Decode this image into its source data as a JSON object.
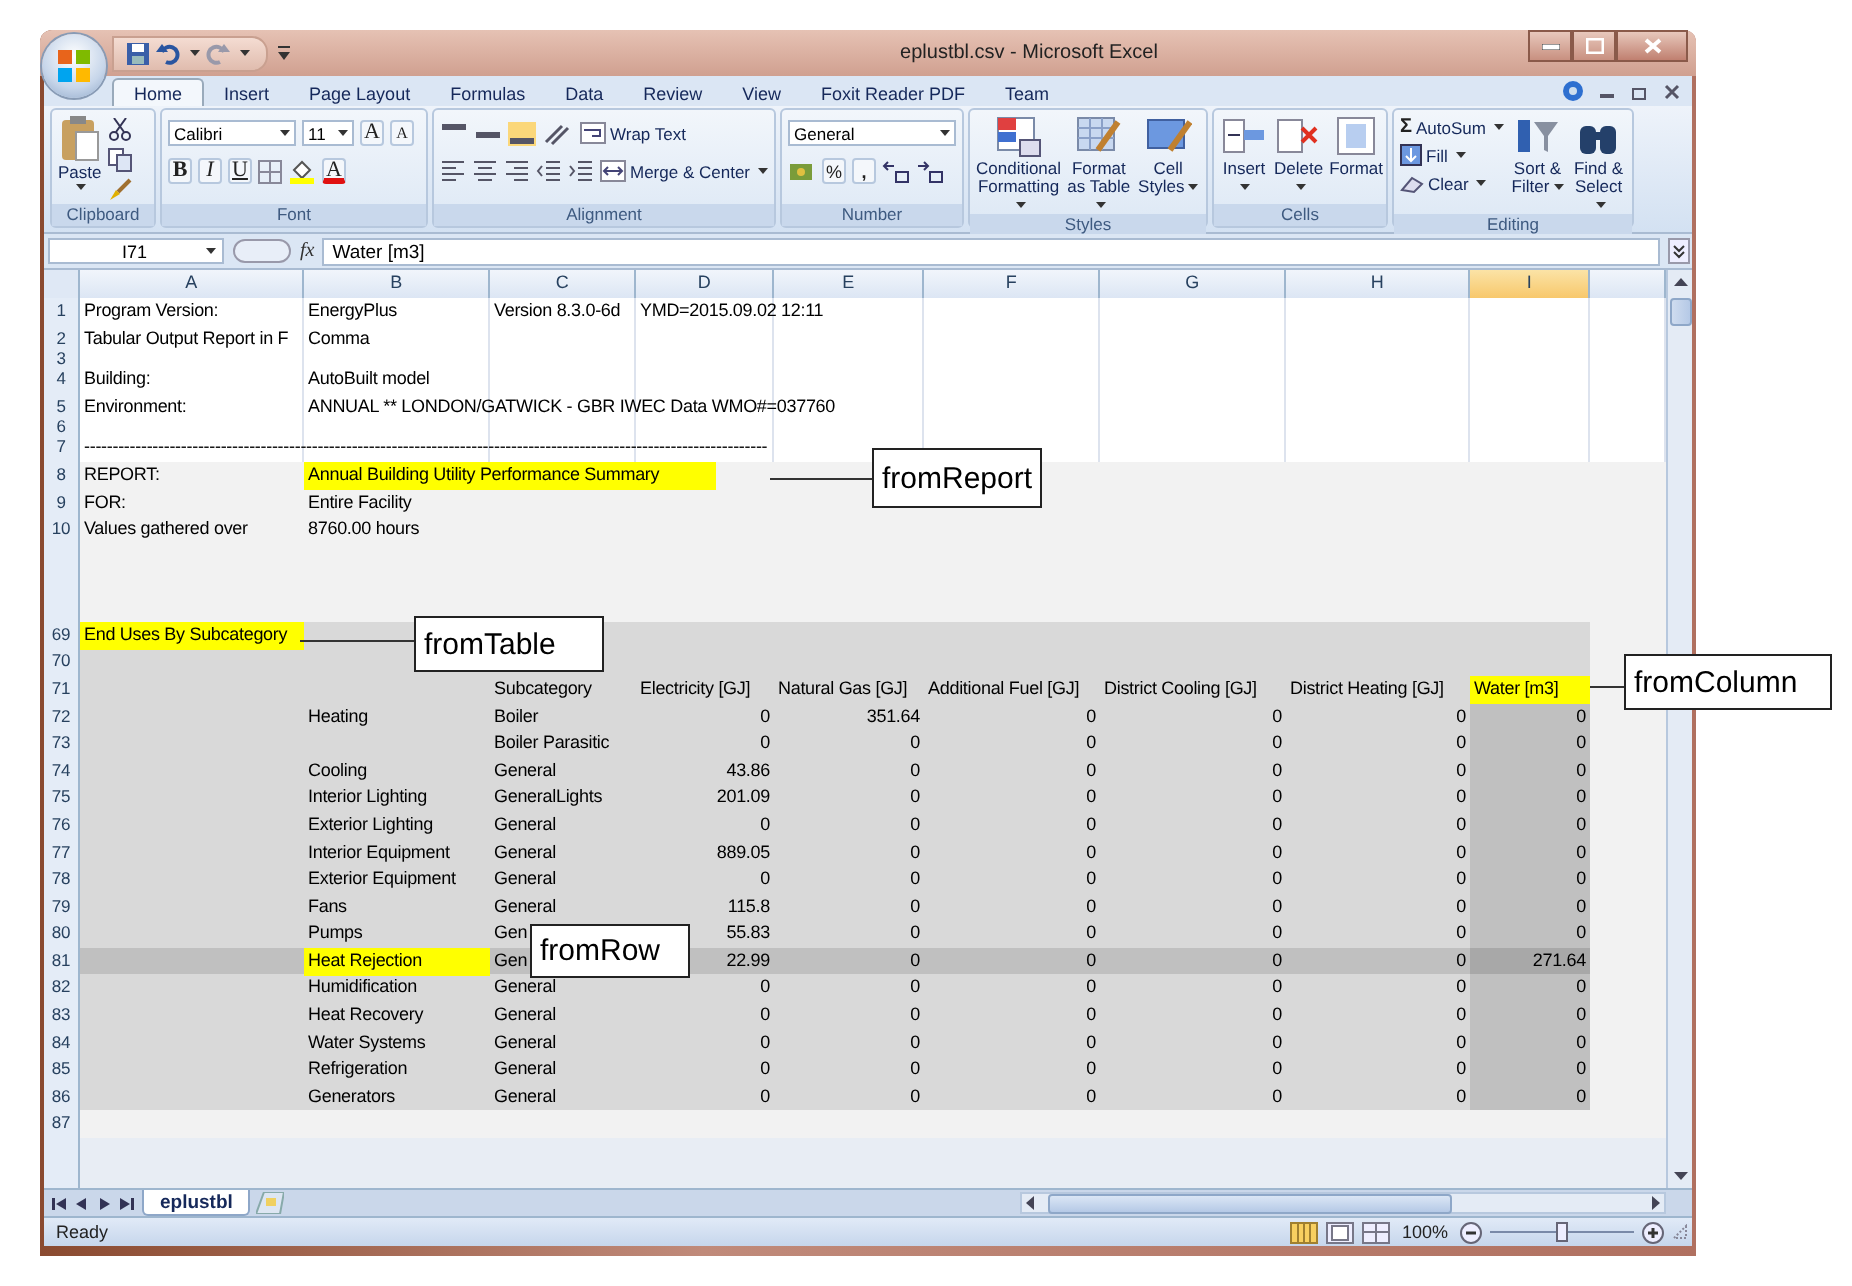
{
  "window": {
    "title": "eplustbl.csv - Microsoft Excel"
  },
  "ribbon_tabs": [
    {
      "label": "Home",
      "selected": true
    },
    {
      "label": "Insert",
      "selected": false
    },
    {
      "label": "Page Layout",
      "selected": false
    },
    {
      "label": "Formulas",
      "selected": false
    },
    {
      "label": "Data",
      "selected": false
    },
    {
      "label": "Review",
      "selected": false
    },
    {
      "label": "View",
      "selected": false
    },
    {
      "label": "Foxit Reader PDF",
      "selected": false
    },
    {
      "label": "Team",
      "selected": false
    }
  ],
  "ribbon_groups": [
    {
      "kind": "clipboard",
      "label": "Clipboard",
      "paste": "Paste"
    },
    {
      "kind": "font",
      "label": "Font",
      "font_name": "Calibri",
      "font_size": "11",
      "grow": "A",
      "shrink": "A",
      "bold": "B",
      "italic": "I",
      "underline": "U",
      "font_color": "A"
    },
    {
      "kind": "alignment",
      "label": "Alignment",
      "wrap_text": "Wrap Text",
      "merge": "Merge & Center"
    },
    {
      "kind": "number",
      "label": "Number",
      "format": "General",
      "percent": "%",
      "comma": ","
    },
    {
      "kind": "styles",
      "label": "Styles",
      "buttons": [
        "Conditional Formatting",
        "Format as Table",
        "Cell Styles"
      ]
    },
    {
      "kind": "cells",
      "label": "Cells",
      "buttons": [
        "Insert",
        "Delete",
        "Format"
      ]
    },
    {
      "kind": "editing",
      "label": "Editing",
      "autosum_symbol": "Σ",
      "small_buttons": [
        "AutoSum",
        "Fill",
        "Clear"
      ],
      "buttons": [
        "Sort & Filter",
        "Find & Select"
      ]
    }
  ],
  "formula_bar": {
    "name_box": "I71",
    "function_label": "fx",
    "formula": "Water [m3]"
  },
  "sheet": {
    "columns": [
      {
        "label": "A",
        "selected": false
      },
      {
        "label": "B",
        "selected": false
      },
      {
        "label": "C",
        "selected": false
      },
      {
        "label": "D",
        "selected": false
      },
      {
        "label": "E",
        "selected": false
      },
      {
        "label": "F",
        "selected": false
      },
      {
        "label": "G",
        "selected": false
      },
      {
        "label": "H",
        "selected": false
      },
      {
        "label": "I",
        "selected": true
      }
    ],
    "rows": [
      {
        "number": "1",
        "kind": "plain",
        "selected": false,
        "cells": [
          {
            "text": "Program Version:",
            "highlighted": false
          },
          {
            "text": "EnergyPlus",
            "highlighted": false
          },
          {
            "text": "Version 8.3.0-6d",
            "highlighted": false
          },
          {
            "text": "YMD=2015.09.02 12:11",
            "highlighted": false
          }
        ]
      },
      {
        "number": "2",
        "kind": "plain",
        "selected": false,
        "cells": [
          {
            "text": "Tabular Output Report in F",
            "highlighted": false
          },
          {
            "text": "Comma",
            "highlighted": false
          }
        ]
      },
      {
        "number": "3",
        "kind": "thin",
        "selected": false,
        "cells": []
      },
      {
        "number": "4",
        "kind": "plain",
        "selected": false,
        "cells": [
          {
            "text": "Building:",
            "highlighted": false
          },
          {
            "text": "AutoBuilt model",
            "highlighted": false
          }
        ]
      },
      {
        "number": "5",
        "kind": "plain",
        "selected": false,
        "cells": [
          {
            "text": "Environment:",
            "highlighted": false
          },
          {
            "text": "ANNUAL ** LONDON/GATWICK - GBR IWEC Data WMO#=037760",
            "highlighted": false
          }
        ]
      },
      {
        "number": "6",
        "kind": "thin",
        "selected": false,
        "cells": []
      },
      {
        "number": "7",
        "kind": "plain",
        "selected": false,
        "cells": [
          {
            "text": "------------------------------------------------------------------------------------------------------------------------",
            "highlighted": false
          }
        ]
      },
      {
        "number": "8",
        "kind": "report",
        "selected": false,
        "cells": [
          {
            "text": "REPORT:",
            "highlighted": false
          },
          {
            "text": "Annual Building Utility Performance Summary",
            "highlighted": true
          }
        ]
      },
      {
        "number": "9",
        "kind": "report",
        "selected": false,
        "cells": [
          {
            "text": "FOR:",
            "highlighted": false
          },
          {
            "text": "Entire Facility",
            "highlighted": false
          }
        ]
      },
      {
        "number": "10",
        "kind": "report",
        "selected": false,
        "cells": [
          {
            "text": "Values gathered over",
            "highlighted": false
          },
          {
            "text": "8760.00 hours",
            "highlighted": false
          }
        ]
      },
      {
        "number": "69",
        "kind": "table",
        "selected": false,
        "cells": [
          {
            "text": "End Uses By Subcategory",
            "highlighted": true
          }
        ]
      },
      {
        "number": "70",
        "kind": "table",
        "selected": false,
        "cells": []
      },
      {
        "number": "71",
        "kind": "table-header",
        "selected": false,
        "cells": [
          null,
          null,
          {
            "text": "Subcategory",
            "highlighted": false
          },
          {
            "text": "Electricity [GJ]",
            "highlighted": false
          },
          {
            "text": "Natural Gas [GJ]",
            "highlighted": false
          },
          {
            "text": "Additional Fuel [GJ]",
            "highlighted": false
          },
          {
            "text": "District Cooling [GJ]",
            "highlighted": false
          },
          {
            "text": "District Heating [GJ]",
            "highlighted": false
          },
          {
            "text": "Water [m3]",
            "highlighted": true
          }
        ]
      },
      {
        "number": "72",
        "kind": "table",
        "selected": false,
        "cells": [
          null,
          {
            "text": "Heating",
            "highlighted": false
          },
          {
            "text": "Boiler",
            "highlighted": false
          },
          {
            "text": "0",
            "highlighted": false
          },
          {
            "text": "351.64",
            "highlighted": false
          },
          {
            "text": "0",
            "highlighted": false
          },
          {
            "text": "0",
            "highlighted": false
          },
          {
            "text": "0",
            "highlighted": false
          },
          {
            "text": "0",
            "highlighted": false
          }
        ]
      },
      {
        "number": "73",
        "kind": "table",
        "selected": false,
        "cells": [
          null,
          null,
          {
            "text": "Boiler Parasitic",
            "highlighted": false
          },
          {
            "text": "0",
            "highlighted": false
          },
          {
            "text": "0",
            "highlighted": false
          },
          {
            "text": "0",
            "highlighted": false
          },
          {
            "text": "0",
            "highlighted": false
          },
          {
            "text": "0",
            "highlighted": false
          },
          {
            "text": "0",
            "highlighted": false
          }
        ]
      },
      {
        "number": "74",
        "kind": "table",
        "selected": false,
        "cells": [
          null,
          {
            "text": "Cooling",
            "highlighted": false
          },
          {
            "text": "General",
            "highlighted": false
          },
          {
            "text": "43.86",
            "highlighted": false
          },
          {
            "text": "0",
            "highlighted": false
          },
          {
            "text": "0",
            "highlighted": false
          },
          {
            "text": "0",
            "highlighted": false
          },
          {
            "text": "0",
            "highlighted": false
          },
          {
            "text": "0",
            "highlighted": false
          }
        ]
      },
      {
        "number": "75",
        "kind": "table",
        "selected": false,
        "cells": [
          null,
          {
            "text": "Interior Lighting",
            "highlighted": false
          },
          {
            "text": "GeneralLights",
            "highlighted": false
          },
          {
            "text": "201.09",
            "highlighted": false
          },
          {
            "text": "0",
            "highlighted": false
          },
          {
            "text": "0",
            "highlighted": false
          },
          {
            "text": "0",
            "highlighted": false
          },
          {
            "text": "0",
            "highlighted": false
          },
          {
            "text": "0",
            "highlighted": false
          }
        ]
      },
      {
        "number": "76",
        "kind": "table",
        "selected": false,
        "cells": [
          null,
          {
            "text": "Exterior Lighting",
            "highlighted": false
          },
          {
            "text": "General",
            "highlighted": false
          },
          {
            "text": "0",
            "highlighted": false
          },
          {
            "text": "0",
            "highlighted": false
          },
          {
            "text": "0",
            "highlighted": false
          },
          {
            "text": "0",
            "highlighted": false
          },
          {
            "text": "0",
            "highlighted": false
          },
          {
            "text": "0",
            "highlighted": false
          }
        ]
      },
      {
        "number": "77",
        "kind": "table",
        "selected": false,
        "cells": [
          null,
          {
            "text": "Interior Equipment",
            "highlighted": false
          },
          {
            "text": "General",
            "highlighted": false
          },
          {
            "text": "889.05",
            "highlighted": false
          },
          {
            "text": "0",
            "highlighted": false
          },
          {
            "text": "0",
            "highlighted": false
          },
          {
            "text": "0",
            "highlighted": false
          },
          {
            "text": "0",
            "highlighted": false
          },
          {
            "text": "0",
            "highlighted": false
          }
        ]
      },
      {
        "number": "78",
        "kind": "table",
        "selected": false,
        "cells": [
          null,
          {
            "text": "Exterior Equipment",
            "highlighted": false
          },
          {
            "text": "General",
            "highlighted": false
          },
          {
            "text": "0",
            "highlighted": false
          },
          {
            "text": "0",
            "highlighted": false
          },
          {
            "text": "0",
            "highlighted": false
          },
          {
            "text": "0",
            "highlighted": false
          },
          {
            "text": "0",
            "highlighted": false
          },
          {
            "text": "0",
            "highlighted": false
          }
        ]
      },
      {
        "number": "79",
        "kind": "table",
        "selected": false,
        "cells": [
          null,
          {
            "text": "Fans",
            "highlighted": false
          },
          {
            "text": "General",
            "highlighted": false
          },
          {
            "text": "115.8",
            "highlighted": false
          },
          {
            "text": "0",
            "highlighted": false
          },
          {
            "text": "0",
            "highlighted": false
          },
          {
            "text": "0",
            "highlighted": false
          },
          {
            "text": "0",
            "highlighted": false
          },
          {
            "text": "0",
            "highlighted": false
          }
        ]
      },
      {
        "number": "80",
        "kind": "table",
        "selected": false,
        "cells": [
          null,
          {
            "text": "Pumps",
            "highlighted": false
          },
          {
            "text": "Gen",
            "highlighted": false
          },
          {
            "text": "55.83",
            "highlighted": false
          },
          {
            "text": "0",
            "highlighted": false
          },
          {
            "text": "0",
            "highlighted": false
          },
          {
            "text": "0",
            "highlighted": false
          },
          {
            "text": "0",
            "highlighted": false
          },
          {
            "text": "0",
            "highlighted": false
          }
        ]
      },
      {
        "number": "81",
        "kind": "table",
        "selected": true,
        "cells": [
          null,
          {
            "text": "Heat Rejection",
            "highlighted": true
          },
          {
            "text": "Gen",
            "highlighted": false
          },
          {
            "text": "22.99",
            "highlighted": false
          },
          {
            "text": "0",
            "highlighted": false
          },
          {
            "text": "0",
            "highlighted": false
          },
          {
            "text": "0",
            "highlighted": false
          },
          {
            "text": "0",
            "highlighted": false
          },
          {
            "text": "271.64",
            "highlighted": false
          }
        ]
      },
      {
        "number": "82",
        "kind": "table",
        "selected": false,
        "cells": [
          null,
          {
            "text": "Humidification",
            "highlighted": false
          },
          {
            "text": "General",
            "highlighted": false
          },
          {
            "text": "0",
            "highlighted": false
          },
          {
            "text": "0",
            "highlighted": false
          },
          {
            "text": "0",
            "highlighted": false
          },
          {
            "text": "0",
            "highlighted": false
          },
          {
            "text": "0",
            "highlighted": false
          },
          {
            "text": "0",
            "highlighted": false
          }
        ]
      },
      {
        "number": "83",
        "kind": "table",
        "selected": false,
        "cells": [
          null,
          {
            "text": "Heat Recovery",
            "highlighted": false
          },
          {
            "text": "General",
            "highlighted": false
          },
          {
            "text": "0",
            "highlighted": false
          },
          {
            "text": "0",
            "highlighted": false
          },
          {
            "text": "0",
            "highlighted": false
          },
          {
            "text": "0",
            "highlighted": false
          },
          {
            "text": "0",
            "highlighted": false
          },
          {
            "text": "0",
            "highlighted": false
          }
        ]
      },
      {
        "number": "84",
        "kind": "table",
        "selected": false,
        "cells": [
          null,
          {
            "text": "Water Systems",
            "highlighted": false
          },
          {
            "text": "General",
            "highlighted": false
          },
          {
            "text": "0",
            "highlighted": false
          },
          {
            "text": "0",
            "highlighted": false
          },
          {
            "text": "0",
            "highlighted": false
          },
          {
            "text": "0",
            "highlighted": false
          },
          {
            "text": "0",
            "highlighted": false
          },
          {
            "text": "0",
            "highlighted": false
          }
        ]
      },
      {
        "number": "85",
        "kind": "table",
        "selected": false,
        "cells": [
          null,
          {
            "text": "Refrigeration",
            "highlighted": false
          },
          {
            "text": "General",
            "highlighted": false
          },
          {
            "text": "0",
            "highlighted": false
          },
          {
            "text": "0",
            "highlighted": false
          },
          {
            "text": "0",
            "highlighted": false
          },
          {
            "text": "0",
            "highlighted": false
          },
          {
            "text": "0",
            "highlighted": false
          },
          {
            "text": "0",
            "highlighted": false
          }
        ]
      },
      {
        "number": "86",
        "kind": "table",
        "selected": false,
        "cells": [
          null,
          {
            "text": "Generators",
            "highlighted": false
          },
          {
            "text": "General",
            "highlighted": false
          },
          {
            "text": "0",
            "highlighted": false
          },
          {
            "text": "0",
            "highlighted": false
          },
          {
            "text": "0",
            "highlighted": false
          },
          {
            "text": "0",
            "highlighted": false
          },
          {
            "text": "0",
            "highlighted": false
          },
          {
            "text": "0",
            "highlighted": false
          }
        ]
      },
      {
        "number": "87",
        "kind": "end",
        "selected": false,
        "cells": []
      }
    ]
  },
  "sheet_tabs": [
    {
      "label": "eplustbl",
      "selected": true
    }
  ],
  "status_bar": {
    "status": "Ready",
    "zoom": {
      "label": "100%",
      "level": 0.5
    }
  },
  "callouts": [
    {
      "text": "fromReport"
    },
    {
      "text": "fromTable"
    },
    {
      "text": "fromRow"
    },
    {
      "text": "fromColumn"
    }
  ]
}
